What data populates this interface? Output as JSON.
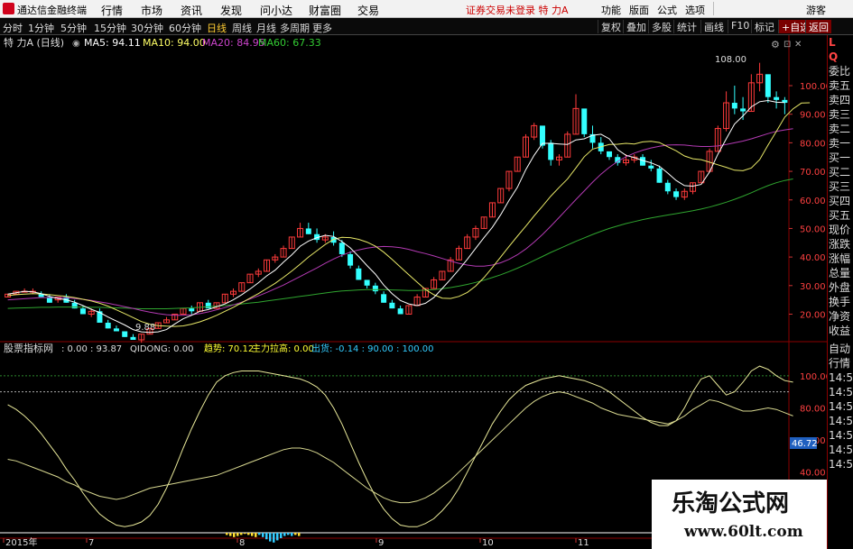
{
  "titlebar": {
    "app_name": "通达信金融终端",
    "menus": [
      "行情",
      "市场",
      "资讯",
      "发现",
      "问小达",
      "财富圈",
      "交易"
    ],
    "notice": "证券交易未登录  特 力A",
    "right_buttons": [
      "功能",
      "版面",
      "公式",
      "选项"
    ],
    "guest": "游客"
  },
  "toolbar": {
    "periods": [
      "分时",
      "1分钟",
      "5分钟",
      "15分钟",
      "30分钟",
      "60分钟",
      "日线",
      "周线",
      "月线",
      "多周期",
      "更多"
    ],
    "active_period": "日线",
    "right_buttons": [
      "复权",
      "叠加",
      "多股",
      "统计",
      "画线",
      "F10",
      "标记",
      "+自选",
      "返回"
    ]
  },
  "main_chart": {
    "stock": "特 力A (日线)",
    "ma_labels": [
      {
        "text": "MA5: 94.11",
        "color": "#ffffff"
      },
      {
        "text": "MA10: 94.00",
        "color": "#ffff66"
      },
      {
        "text": "MA20: 84.95",
        "color": "#cc44cc"
      },
      {
        "text": "MA60: 67.33",
        "color": "#33cc33"
      }
    ],
    "price_axis": [
      "100.00",
      "90.00",
      "80.00",
      "70.00",
      "60.00",
      "50.00",
      "40.00",
      "30.00",
      "20.00"
    ],
    "high_marker": "108.00",
    "low_marker": "9.88"
  },
  "indicator": {
    "name": "股票指标网",
    "values_text": ": 0.00 : 93.87",
    "qidong": "QIDONG: 0.00",
    "qushi": "趋势: 70.12",
    "zhuli": "主力拉高: 0.00",
    "chuhuo": "出货: -0.14 : 90.00 : 100.00",
    "axis": [
      "100.00",
      "80.00",
      "60.00",
      "40.00"
    ],
    "current_value": "46.72"
  },
  "x_axis": [
    "2015年",
    "7",
    "8",
    "9",
    "10",
    "11"
  ],
  "right_panel": {
    "top": [
      "L",
      "Q"
    ],
    "labels": [
      "委比",
      "卖五",
      "卖四",
      "卖三",
      "卖二",
      "卖一",
      "买一",
      "买二",
      "买三",
      "买四",
      "买五",
      "现价",
      "涨跌",
      "涨幅",
      "总量",
      "外盘",
      "换手",
      "净资",
      "收益"
    ],
    "bottom_labels": [
      "自动",
      "行情"
    ],
    "times": [
      "14:50",
      "14:50",
      "14:50",
      "14:50",
      "14:50",
      "14:50",
      "14:50"
    ]
  },
  "watermark": {
    "line1": "乐淘公式网",
    "line2": "www.60lt.com"
  },
  "chart_data": {
    "type": "candlestick",
    "price_range": [
      11,
      112
    ],
    "candles": [
      [
        26,
        27,
        26,
        27
      ],
      [
        27,
        28,
        27,
        28
      ],
      [
        28,
        29,
        28,
        28
      ],
      [
        28,
        29,
        27,
        28
      ],
      [
        27,
        28,
        26,
        26
      ],
      [
        26,
        27,
        24,
        24
      ],
      [
        25,
        26,
        24,
        26
      ],
      [
        26,
        27,
        24,
        24
      ],
      [
        24,
        25,
        22,
        22
      ],
      [
        22,
        23,
        20,
        20
      ],
      [
        20,
        22,
        19,
        21
      ],
      [
        21,
        22,
        17,
        17
      ],
      [
        17,
        18,
        15,
        15
      ],
      [
        15,
        16,
        14,
        14
      ],
      [
        14,
        14,
        12,
        12
      ],
      [
        12,
        13,
        11,
        11
      ],
      [
        11,
        13,
        10,
        13
      ],
      [
        13,
        15,
        13,
        15
      ],
      [
        15,
        17,
        15,
        17
      ],
      [
        17,
        19,
        17,
        18
      ],
      [
        18,
        20,
        18,
        20
      ],
      [
        20,
        22,
        20,
        22
      ],
      [
        22,
        23,
        20,
        21
      ],
      [
        21,
        24,
        21,
        24
      ],
      [
        24,
        25,
        22,
        22
      ],
      [
        22,
        24,
        22,
        24
      ],
      [
        24,
        27,
        24,
        27
      ],
      [
        27,
        29,
        26,
        28
      ],
      [
        28,
        31,
        28,
        31
      ],
      [
        31,
        34,
        31,
        34
      ],
      [
        34,
        36,
        33,
        35
      ],
      [
        35,
        39,
        35,
        39
      ],
      [
        39,
        41,
        38,
        40
      ],
      [
        40,
        44,
        40,
        43
      ],
      [
        43,
        47,
        43,
        47
      ],
      [
        47,
        52,
        47,
        50
      ],
      [
        50,
        52,
        48,
        48
      ],
      [
        48,
        50,
        45,
        46
      ],
      [
        46,
        48,
        45,
        47
      ],
      [
        47,
        49,
        44,
        45
      ],
      [
        45,
        46,
        40,
        41
      ],
      [
        41,
        42,
        36,
        37
      ],
      [
        36,
        37,
        32,
        32
      ],
      [
        32,
        32,
        29,
        30
      ],
      [
        30,
        31,
        27,
        28
      ],
      [
        27,
        28,
        24,
        24
      ],
      [
        24,
        25,
        22,
        22
      ],
      [
        22,
        23,
        20,
        20
      ],
      [
        20,
        23,
        20,
        23
      ],
      [
        23,
        27,
        23,
        26
      ],
      [
        26,
        29,
        26,
        29
      ],
      [
        29,
        33,
        29,
        32
      ],
      [
        32,
        35,
        32,
        35
      ],
      [
        35,
        40,
        35,
        39
      ],
      [
        39,
        44,
        39,
        43
      ],
      [
        43,
        48,
        43,
        47
      ],
      [
        47,
        51,
        46,
        50
      ],
      [
        50,
        54,
        50,
        54
      ],
      [
        54,
        59,
        54,
        59
      ],
      [
        59,
        64,
        59,
        64
      ],
      [
        64,
        70,
        63,
        70
      ],
      [
        70,
        75,
        70,
        75
      ],
      [
        75,
        83,
        75,
        82
      ],
      [
        82,
        87,
        81,
        86
      ],
      [
        86,
        80,
        78,
        79
      ],
      [
        80,
        81,
        72,
        74
      ],
      [
        74,
        76,
        72,
        75
      ],
      [
        75,
        84,
        75,
        83
      ],
      [
        83,
        97,
        83,
        92
      ],
      [
        92,
        88,
        82,
        83
      ],
      [
        83,
        86,
        78,
        80
      ],
      [
        80,
        82,
        76,
        77
      ],
      [
        77,
        76,
        74,
        75
      ],
      [
        75,
        76,
        72,
        73
      ],
      [
        73,
        76,
        72,
        74
      ],
      [
        74,
        76,
        73,
        75
      ],
      [
        75,
        76,
        72,
        72
      ],
      [
        72,
        74,
        70,
        71
      ],
      [
        71,
        72,
        66,
        66
      ],
      [
        66,
        67,
        62,
        63
      ],
      [
        63,
        64,
        60,
        61
      ],
      [
        61,
        64,
        60,
        63
      ],
      [
        63,
        66,
        62,
        66
      ],
      [
        66,
        70,
        66,
        70
      ],
      [
        70,
        78,
        70,
        77
      ],
      [
        77,
        86,
        77,
        85
      ],
      [
        85,
        98,
        84,
        94
      ],
      [
        94,
        100,
        90,
        92
      ],
      [
        92,
        96,
        88,
        91
      ],
      [
        91,
        104,
        91,
        101
      ],
      [
        101,
        108,
        98,
        104
      ],
      [
        104,
        100,
        94,
        96
      ],
      [
        96,
        98,
        92,
        95
      ],
      [
        95,
        96,
        90,
        94
      ]
    ],
    "ma5": [
      27,
      27.5,
      28,
      27.8,
      27.2,
      26.2,
      25.5,
      25,
      24.2,
      23,
      21.7,
      20.6,
      19,
      17.6,
      16.2,
      14.6,
      13.8,
      13.6,
      13.8,
      14.6,
      16.6,
      18.4,
      19.6,
      21,
      21.6,
      22.6,
      23.6,
      25,
      26.8,
      28.8,
      31,
      33.4,
      35.4,
      38.2,
      40.8,
      43.8,
      45.6,
      46.8,
      47.6,
      47.2,
      45.4,
      43.2,
      40.2,
      37,
      34,
      30.2,
      27.2,
      24.8,
      23.6,
      23,
      23.8,
      25.8,
      29,
      32.2,
      35.6,
      39.2,
      43,
      46.8,
      50.4,
      54.8,
      59.8,
      64.4,
      70.6,
      75.6,
      79.8,
      79.8,
      79.6,
      79.4,
      81,
      81.4,
      82.6,
      83,
      81.4,
      77.6,
      75.6,
      74.8,
      73.8,
      73,
      71.8,
      69.4,
      66.8,
      65,
      64.8,
      65.4,
      69.8,
      76,
      81.4,
      86.6,
      89.4,
      92.6,
      94.4,
      94.8,
      94.2,
      94.1
    ],
    "ma10": [
      26.5,
      26.8,
      27,
      27.2,
      27.1,
      26.8,
      26.5,
      26.2,
      25.8,
      25.2,
      24.6,
      23.8,
      22.8,
      21.5,
      20.2,
      18.8,
      17.4,
      16.5,
      16,
      15.8,
      15.7,
      15.9,
      16.5,
      17.3,
      18.4,
      19.6,
      21,
      22.4,
      24,
      25.6,
      27.2,
      29,
      30.8,
      32.9,
      35.1,
      37.5,
      40,
      42.2,
      44.4,
      46.2,
      46.9,
      46.8,
      46.2,
      45.2,
      43.8,
      41.7,
      39.2,
      36.5,
      33.8,
      31.2,
      28.6,
      26.8,
      25.6,
      25.5,
      26.2,
      27.6,
      29.8,
      32.8,
      36.3,
      40,
      43.7,
      47.3,
      50.8,
      54.4,
      57.8,
      61.3,
      64.4,
      67.3,
      71.2,
      75.1,
      77.8,
      78.6,
      79.4,
      79.5,
      79.8,
      79.6,
      80.3,
      80.5,
      80.1,
      78.6,
      77.2,
      75.4,
      74.4,
      74.1,
      73.2,
      72.3,
      71.4,
      70.4,
      70.2,
      71.2,
      74.1,
      79.2,
      84,
      89,
      91.9,
      93.9,
      94
    ],
    "ma20": [
      25,
      25.2,
      25.4,
      25.6,
      25.8,
      25.8,
      25.8,
      25.7,
      25.5,
      25.2,
      24.8,
      24.3,
      23.8,
      23.2,
      22.6,
      22,
      21.3,
      20.7,
      20.2,
      19.8,
      19.6,
      19.6,
      19.8,
      20.2,
      20.8,
      21.5,
      22.3,
      23.2,
      24.2,
      25.3,
      26.4,
      27.6,
      28.9,
      30.2,
      31.7,
      33.2,
      34.7,
      36.2,
      37.8,
      39.3,
      40.6,
      41.7,
      42.5,
      43.1,
      43.5,
      43.7,
      43.6,
      43.3,
      42.7,
      41.9,
      41.2,
      40.4,
      39.5,
      38.6,
      37.8,
      37.2,
      36.8,
      36.8,
      37.2,
      38,
      39.2,
      40.8,
      42.8,
      45.2,
      47.9,
      50.8,
      53.9,
      57,
      60.1,
      63.1,
      66.2,
      69,
      71.4,
      73.5,
      75.1,
      76.4,
      77.4,
      78.2,
      78.8,
      79.2,
      79.3,
      79.2,
      78.9,
      78.7,
      78.7,
      78.9,
      79.4,
      80,
      80.6,
      81.4,
      82.3,
      83.2,
      84,
      84.5,
      84.95
    ],
    "ma60": [
      22,
      22.1,
      22.2,
      22.3,
      22.4,
      22.4,
      22.5,
      22.5,
      22.5,
      22.5,
      22.4,
      22.4,
      22.3,
      22.2,
      22.1,
      22,
      21.9,
      21.9,
      21.9,
      21.9,
      22,
      22.1,
      22.2,
      22.4,
      22.6,
      22.8,
      23,
      23.3,
      23.6,
      23.9,
      24.2,
      24.6,
      25,
      25.4,
      25.8,
      26.2,
      26.6,
      27,
      27.4,
      27.8,
      28.1,
      28.3,
      28.5,
      28.6,
      28.6,
      28.6,
      28.5,
      28.4,
      28.3,
      28.3,
      28.4,
      28.6,
      28.9,
      29.3,
      29.8,
      30.4,
      31.1,
      31.9,
      32.8,
      33.8,
      34.9,
      36.1,
      37.4,
      38.8,
      40.2,
      41.6,
      42.9,
      44.2,
      45.5,
      46.7,
      47.9,
      49,
      50,
      50.9,
      51.7,
      52.4,
      53.1,
      53.7,
      54.2,
      54.7,
      55.2,
      55.7,
      56.2,
      56.8,
      57.5,
      58.3,
      59.2,
      60.2,
      61.3,
      62.5,
      63.8,
      65,
      66,
      66.8,
      67.33
    ],
    "osc_a": [
      82,
      79,
      75,
      70,
      64,
      57,
      50,
      42,
      35,
      27,
      20,
      14,
      10,
      7,
      6,
      7,
      9,
      13,
      20,
      30,
      42,
      55,
      67,
      78,
      88,
      96,
      100,
      102,
      103,
      103,
      103,
      102,
      101,
      100,
      99,
      98,
      96,
      93,
      88,
      80,
      70,
      58,
      46,
      35,
      25,
      17,
      11,
      7,
      6,
      6,
      8,
      11,
      16,
      22,
      30,
      40,
      50,
      60,
      70,
      78,
      85,
      90,
      94,
      96,
      98,
      99,
      100,
      99,
      98,
      97,
      95,
      93,
      90,
      86,
      82,
      78,
      74,
      71,
      69,
      69,
      72,
      80,
      90,
      98,
      100,
      94,
      88,
      90,
      96,
      103,
      106,
      104,
      100,
      97,
      96
    ],
    "osc_b": [
      48,
      47,
      45,
      43,
      41,
      39,
      37,
      34,
      32,
      29,
      27,
      25,
      24,
      23,
      24,
      26,
      28,
      30,
      31,
      32,
      33,
      34,
      35,
      36,
      37,
      38,
      40,
      42,
      44,
      46,
      48,
      50,
      52,
      54,
      55,
      55,
      54,
      52,
      49,
      46,
      42,
      38,
      34,
      30,
      27,
      24,
      22,
      21,
      21,
      22,
      24,
      27,
      31,
      35,
      40,
      45,
      50,
      55,
      60,
      65,
      70,
      75,
      80,
      84,
      87,
      89,
      90,
      89,
      87,
      85,
      83,
      80,
      78,
      76,
      75,
      74,
      73,
      72,
      71,
      70,
      72,
      75,
      79,
      82,
      85,
      84,
      82,
      80,
      78,
      78,
      79,
      80,
      79,
      77,
      75
    ],
    "volume": [
      2,
      3,
      4,
      3,
      2,
      1,
      2,
      3,
      4,
      -2,
      -4,
      -6,
      -8,
      -9,
      -7,
      -5,
      -3,
      -2,
      -3,
      2,
      3
    ]
  }
}
